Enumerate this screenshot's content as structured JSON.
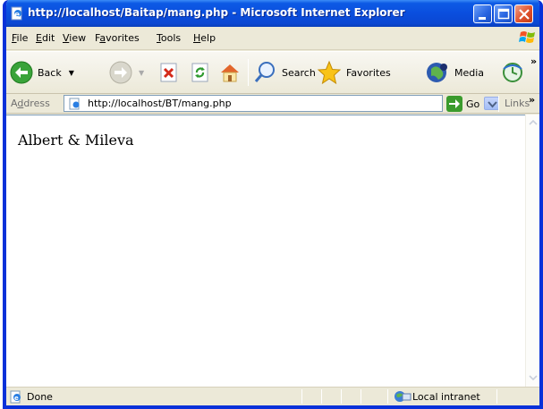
{
  "window": {
    "title": "http://localhost/Baitap/mang.php - Microsoft Internet Explorer"
  },
  "menu": {
    "items": [
      {
        "first": "F",
        "rest": "ile"
      },
      {
        "first": "E",
        "rest": "dit"
      },
      {
        "first": "V",
        "rest": "iew"
      },
      {
        "pre": "F",
        "first": "a",
        "rest": "vorites"
      },
      {
        "first": "T",
        "rest": "ools"
      },
      {
        "first": "H",
        "rest": "elp"
      }
    ]
  },
  "toolbar": {
    "back_label": "Back",
    "search_label": "Search",
    "favorites_label": "Favorites",
    "media_label": "Media"
  },
  "address": {
    "label_pre": "A",
    "label_ul": "d",
    "label_post": "dress",
    "url": "http://localhost/BT/mang.php",
    "go_label": "Go",
    "links_label": "Links"
  },
  "page": {
    "text": "Albert & Mileva"
  },
  "status": {
    "text": "Done",
    "zone": "Local intranet"
  },
  "colors": {
    "titlebar": "#0a4ede",
    "frame": "#0831d9",
    "chrome": "#ece9d8",
    "content_bg": "#ffffff"
  }
}
